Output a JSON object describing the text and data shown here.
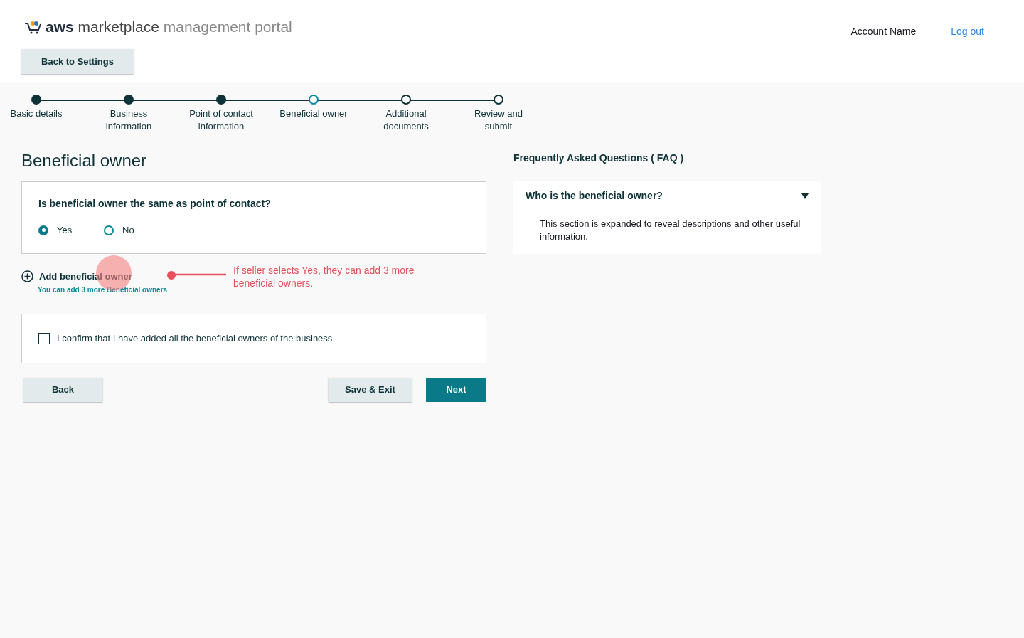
{
  "header": {
    "logo": {
      "brand": "aws",
      "product": "marketplace",
      "suffix": "management portal"
    },
    "account_name": "Account Name",
    "logout": "Log out",
    "back_button": "Back to Settings"
  },
  "steps": [
    {
      "label": "Basic details",
      "kind": "complete"
    },
    {
      "label": "Business information",
      "kind": "complete"
    },
    {
      "label": "Point of contact information",
      "kind": "complete"
    },
    {
      "label": "Beneficial owner",
      "kind": "current"
    },
    {
      "label": "Additional documents",
      "kind": "upcoming"
    },
    {
      "label": "Review and submit",
      "kind": "upcoming"
    }
  ],
  "page_title": "Beneficial owner",
  "question": {
    "text": "Is beneficial owner the same as point of contact?",
    "options": [
      {
        "label": "Yes",
        "selected": true
      },
      {
        "label": "No",
        "selected": false
      }
    ]
  },
  "add_owner": {
    "label": "Add beneficial owner",
    "hint": "You can add 3 more Beneficial owners"
  },
  "annotation": "If seller selects Yes, they can add 3 more beneficial owners.",
  "confirm": {
    "label": "I confirm that I have added all the beneficial owners of the business",
    "checked": false
  },
  "buttons": {
    "back": "Back",
    "save": "Save & Exit",
    "next": "Next"
  },
  "faq": {
    "title": "Frequently Asked Questions ( FAQ )",
    "items": [
      {
        "question": "Who is the beneficial owner?",
        "expanded": true,
        "answer": "This section is expanded to reveal descriptions and other useful information."
      }
    ]
  }
}
